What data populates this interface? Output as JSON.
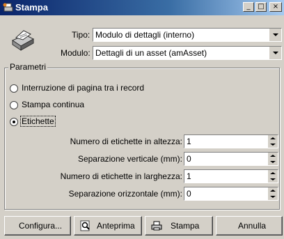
{
  "window": {
    "title": "Stampa",
    "controls": {
      "minimize": "_",
      "maximize": "□",
      "close": "×"
    }
  },
  "header": {
    "tipo_label": "Tipo:",
    "tipo_value": "Modulo di dettagli (interno)",
    "modulo_label": "Modulo:",
    "modulo_value": "Dettagli di un asset (amAsset)"
  },
  "params": {
    "group_title": "Parametri",
    "radio_page_break": "Interruzione di pagina tra i record",
    "radio_continuous": "Stampa continua",
    "radio_labels": "Etichette",
    "selected": "Etichette",
    "fields": [
      {
        "label": "Numero di etichette in altezza:",
        "value": "1"
      },
      {
        "label": "Separazione verticale (mm):",
        "value": "0"
      },
      {
        "label": "Numero di etichette in larghezza:",
        "value": "1"
      },
      {
        "label": "Separazione orizzontale (mm):",
        "value": "0"
      }
    ]
  },
  "buttons": {
    "configure": "Configura...",
    "preview": "Anteprima",
    "print": "Stampa",
    "cancel": "Annulla"
  },
  "icons": {
    "app": "printer-app-icon",
    "printer": "printer-icon",
    "preview": "magnifier-icon",
    "print": "printer-icon"
  }
}
